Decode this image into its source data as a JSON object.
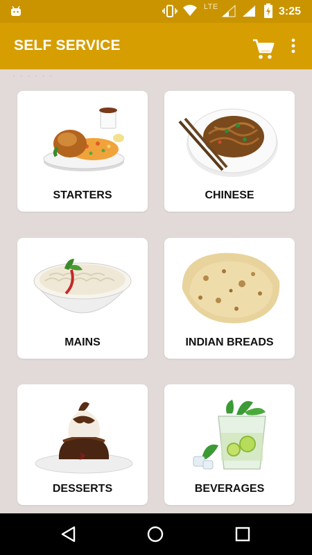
{
  "status_bar": {
    "network_label": "LTE",
    "time": "3:25"
  },
  "app_bar": {
    "title": "SELF SERVICE",
    "cart_icon": "shopping-cart-icon",
    "menu_icon": "more-vert-icon"
  },
  "categories": [
    {
      "label": "STARTERS",
      "image": "fried-chicken-rice-plate"
    },
    {
      "label": "CHINESE",
      "image": "noodles-with-chopsticks"
    },
    {
      "label": "MAINS",
      "image": "rice-bowl"
    },
    {
      "label": "INDIAN BREADS",
      "image": "flatbread"
    },
    {
      "label": "DESSERTS",
      "image": "chocolate-lava-cake"
    },
    {
      "label": "BEVERAGES",
      "image": "mojito-glass"
    }
  ],
  "nav_bar": {
    "back_icon": "back-triangle-icon",
    "home_icon": "home-circle-icon",
    "recents_icon": "recents-square-icon"
  },
  "colors": {
    "app_bar": "#d69e00",
    "status_bar": "#c99400",
    "background": "#e2d9d9",
    "card": "#ffffff"
  }
}
